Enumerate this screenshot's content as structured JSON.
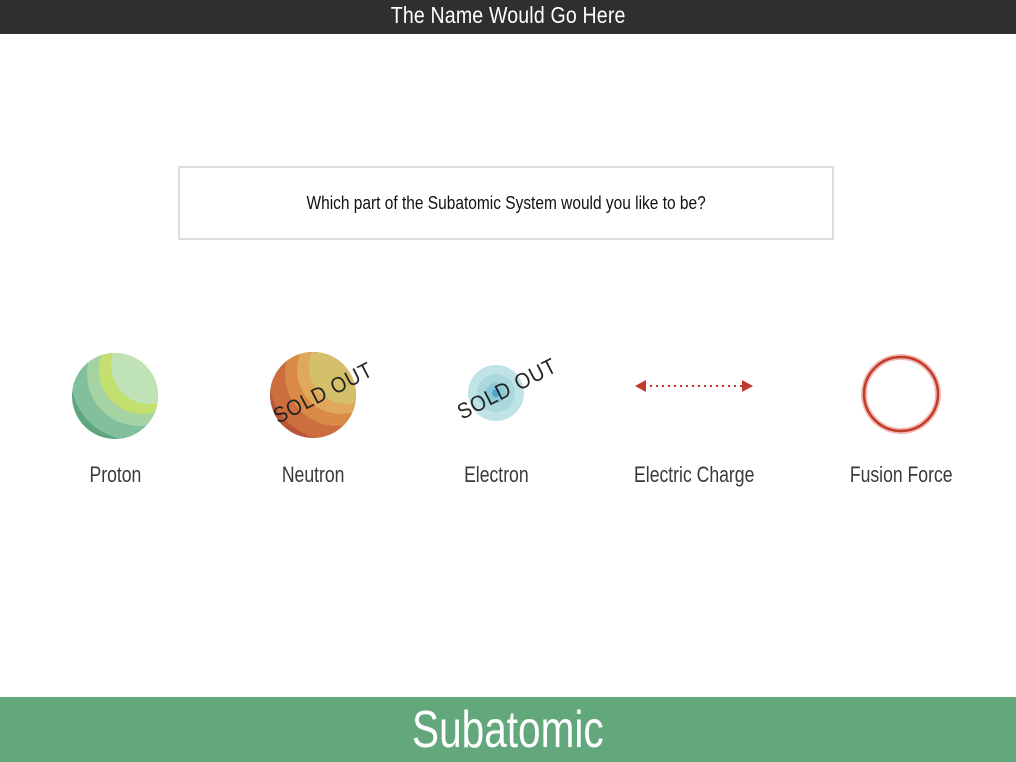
{
  "header": {
    "title": "The Name Would Go Here"
  },
  "question": {
    "text": "Which part of the Subatomic System would you like to be?"
  },
  "options": [
    {
      "label": "Proton",
      "icon": "proton-sphere-icon",
      "sold_out": false
    },
    {
      "label": "Neutron",
      "icon": "neutron-sphere-icon",
      "sold_out": true,
      "sold_out_text": "SOLD OUT"
    },
    {
      "label": "Electron",
      "icon": "electron-sphere-icon",
      "sold_out": true,
      "sold_out_text": "SOLD OUT"
    },
    {
      "label": "Electric Charge",
      "icon": "double-arrow-icon",
      "sold_out": false
    },
    {
      "label": "Fusion Force",
      "icon": "ring-icon",
      "sold_out": false
    }
  ],
  "footer": {
    "title": "Subatomic"
  },
  "colors": {
    "header_bg": "#2f2f2f",
    "footer_bg": "#62a87c",
    "charge_red": "#c0392b",
    "fusion_red": "#c43a2a"
  }
}
